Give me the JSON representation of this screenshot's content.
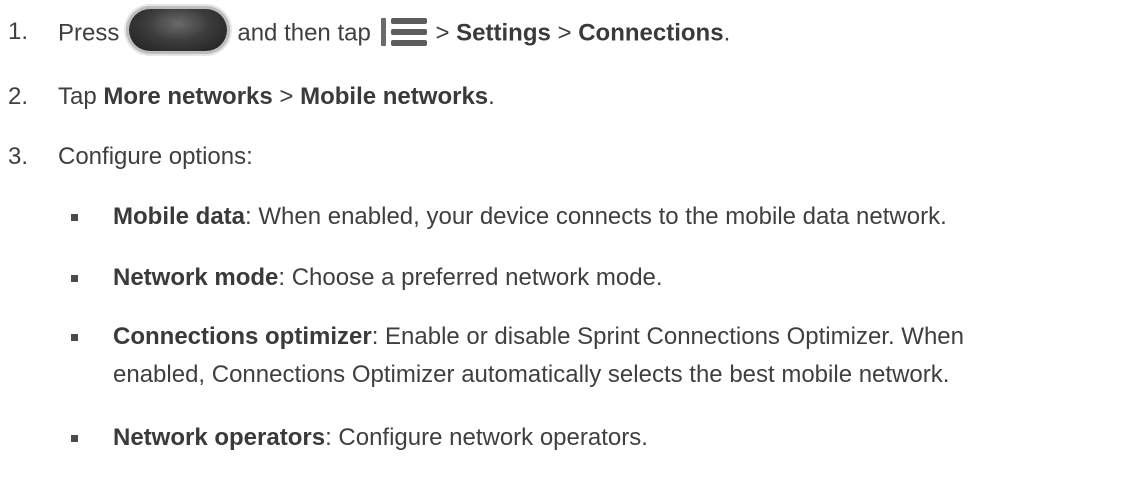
{
  "steps": [
    {
      "number": "1.",
      "pre": "Press",
      "mid": "and then tap",
      "sep1": ">",
      "settings": "Settings",
      "sep2": ">",
      "connections": "Connections",
      "end": "."
    },
    {
      "number": "2.",
      "pre": "Tap",
      "more_networks": "More networks",
      "sep": ">",
      "mobile_networks": "Mobile networks",
      "end": "."
    },
    {
      "number": "3.",
      "text": "Configure options:"
    }
  ],
  "options": [
    {
      "term": "Mobile data",
      "desc": ": When enabled, your device connects to the mobile data network."
    },
    {
      "term": "Network mode",
      "desc": ": Choose a preferred network mode."
    },
    {
      "term": "Connections optimizer",
      "desc": ": Enable or disable Sprint Connections Optimizer. When",
      "desc2": "enabled, Connections Optimizer automatically selects the best mobile network."
    },
    {
      "term": "Network operators",
      "desc": ": Configure network operators."
    }
  ],
  "icons": {
    "home_button": "home-button-icon",
    "menu": "menu-icon"
  }
}
